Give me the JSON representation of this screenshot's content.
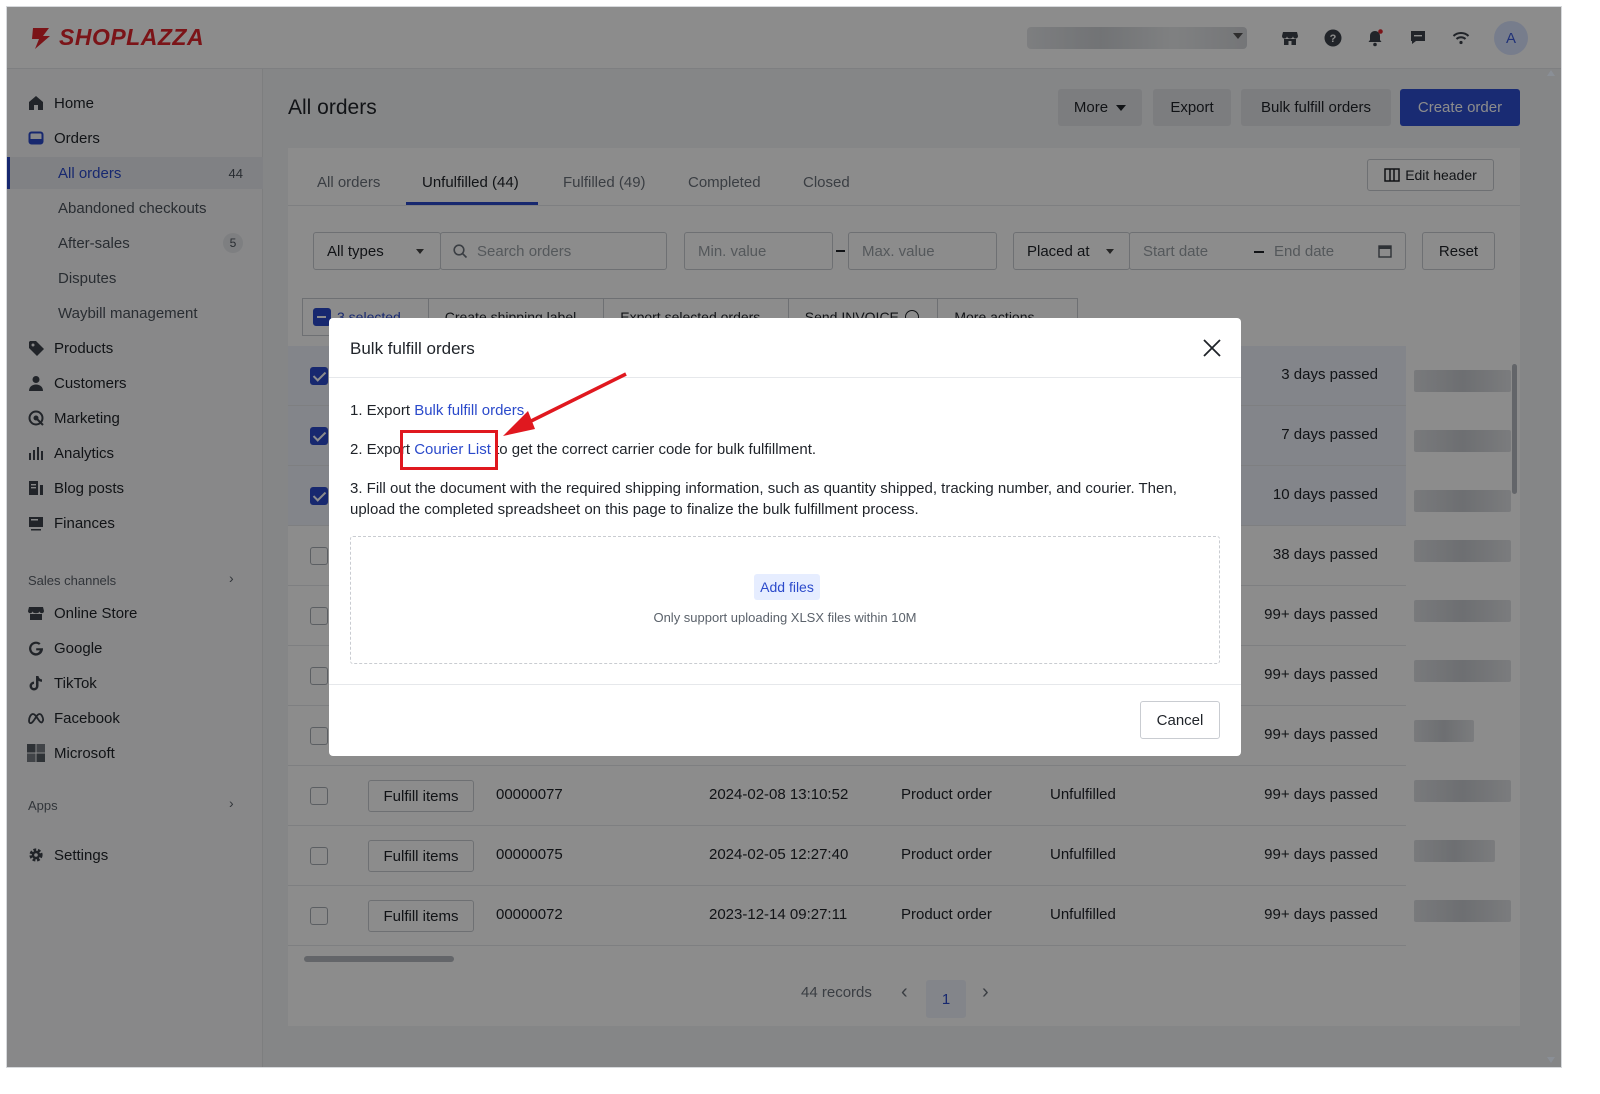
{
  "brand": {
    "name": "SHOPLAZZA",
    "color": "#e0262c",
    "accent": "#2b4acb"
  },
  "topbar": {
    "avatar_letter": "A"
  },
  "sidebar": {
    "home": "Home",
    "orders": "Orders",
    "orders_sub": [
      {
        "label": "All orders",
        "badge": "44"
      },
      {
        "label": "Abandoned checkouts"
      },
      {
        "label": "After-sales",
        "badge": "5"
      },
      {
        "label": "Disputes"
      },
      {
        "label": "Waybill management"
      }
    ],
    "items": [
      "Products",
      "Customers",
      "Marketing",
      "Analytics",
      "Blog posts",
      "Finances"
    ],
    "sales_channels_label": "Sales channels",
    "channels": [
      "Online Store",
      "Google",
      "TikTok",
      "Facebook",
      "Microsoft"
    ],
    "apps_label": "Apps",
    "settings": "Settings"
  },
  "header": {
    "title": "All orders",
    "more": "More",
    "export": "Export",
    "bulk_fulfill": "Bulk fulfill orders",
    "create_order": "Create order"
  },
  "tabs": [
    "All orders",
    "Unfulfilled (44)",
    "Fulfilled (49)",
    "Completed",
    "Closed"
  ],
  "edit_header": "Edit header",
  "filters": {
    "type": "All types",
    "search_placeholder": "Search orders",
    "min_value": "Min. value",
    "max_value": "Max. value",
    "placed_at": "Placed at",
    "start_date": "Start date",
    "end_date": "End date",
    "reset": "Reset"
  },
  "bulk_actions": {
    "selected": "3 selected",
    "create_label": "Create shipping label",
    "export_selected": "Export selected orders",
    "send_invoice": "Send INVOICE",
    "more_actions": "More actions"
  },
  "rows": [
    {
      "selected": true,
      "passed": "3 days passed"
    },
    {
      "selected": true,
      "passed": "7 days passed"
    },
    {
      "selected": true,
      "passed": "10 days passed"
    },
    {
      "selected": false,
      "passed": "38 days passed"
    },
    {
      "selected": false,
      "passed": "99+ days passed"
    },
    {
      "selected": false,
      "passed": "99+ days passed"
    },
    {
      "selected": false,
      "passed": "99+ days passed"
    },
    {
      "selected": false,
      "action": "Fulfill items",
      "number": "00000077",
      "date": "2024-02-08 13:10:52",
      "type": "Product order",
      "status": "Unfulfilled",
      "passed": "99+ days passed"
    },
    {
      "selected": false,
      "action": "Fulfill items",
      "number": "00000075",
      "date": "2024-02-05 12:27:40",
      "type": "Product order",
      "status": "Unfulfilled",
      "passed": "99+ days passed"
    },
    {
      "selected": false,
      "action": "Fulfill items",
      "number": "00000072",
      "date": "2023-12-14 09:27:11",
      "type": "Product order",
      "status": "Unfulfilled",
      "passed": "99+ days passed"
    }
  ],
  "pagination": {
    "records": "44 records",
    "page": "1"
  },
  "modal": {
    "title": "Bulk fulfill orders",
    "step1_prefix": "1. Export ",
    "step1_link": "Bulk fulfill orders",
    "step2_prefix": "2. Export ",
    "step2_link": "Courier List",
    "step2_suffix": " to get the correct carrier code for bulk fulfillment.",
    "step3_line1": "3. Fill out the document with the required shipping information, such as quantity shipped, tracking number, and courier. Then,",
    "step3_line2": "upload the completed spreadsheet on this page to finalize the bulk fulfillment process.",
    "add_files": "Add files",
    "hint": "Only support uploading XLSX files within 10M",
    "cancel": "Cancel"
  },
  "annotation_color": "#e0181f"
}
